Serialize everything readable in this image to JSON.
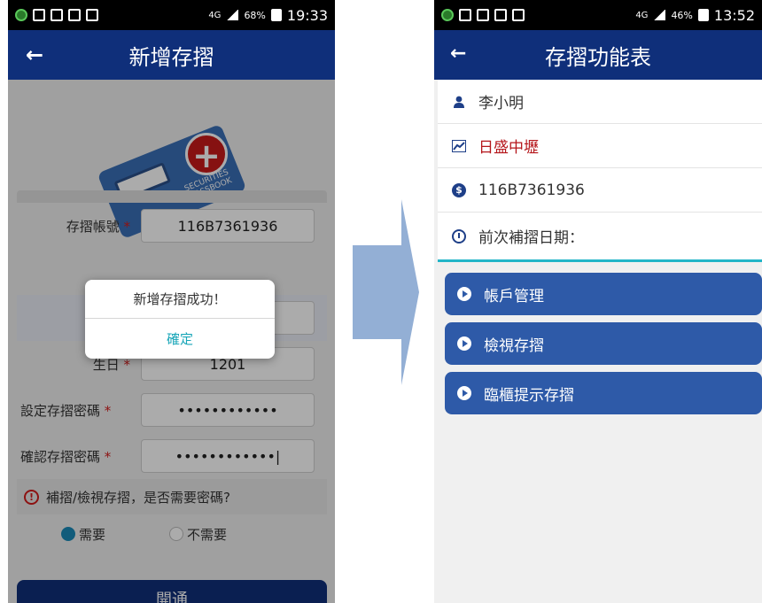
{
  "left": {
    "status": {
      "battery": "68%",
      "time": "19:33",
      "net": "4G"
    },
    "title": "新增存摺",
    "passbook_text": [
      "SECURITIES",
      "PASSBOOK"
    ],
    "fields": {
      "account_label": "存摺帳號",
      "account_value": "116B7361936",
      "birthday_label": "生日",
      "birthday_value": "1201",
      "set_pw_label": "設定存摺密碼",
      "set_pw_value": "••••••••••••",
      "confirm_pw_label": "確認存摺密碼",
      "confirm_pw_value": "••••••••••••|",
      "required_mark": "*"
    },
    "question": "補摺/檢視存摺，是否需要密碼?",
    "options": [
      "需要",
      "不需要"
    ],
    "selected_option": "需要",
    "open_button": "開通",
    "dialog": {
      "message": "新增存摺成功！",
      "ok": "確定"
    }
  },
  "right": {
    "status": {
      "battery": "46%",
      "time": "13:52",
      "net": "4G"
    },
    "title": "存摺功能表",
    "info": {
      "name": "李小明",
      "branch": "日盛中壢",
      "account": "116B7361936",
      "last_update_label": "前次補摺日期："
    },
    "menu": [
      "帳戶管理",
      "檢視存摺",
      "臨櫃提示存摺"
    ]
  },
  "colors": {
    "appbar": "#0f2f7a",
    "menu_button": "#2e5aa8",
    "accent_red": "#b5161b",
    "accent_teal": "#22b5c8",
    "arrow": "#93afd5"
  }
}
